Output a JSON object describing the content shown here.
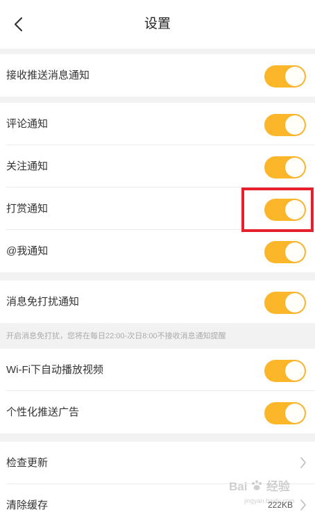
{
  "header": {
    "title": "设置",
    "back_icon": "chevron-left-icon"
  },
  "groups": {
    "push": {
      "items": [
        {
          "label": "接收推送消息通知",
          "on": true
        }
      ]
    },
    "notify": {
      "items": [
        {
          "label": "评论通知",
          "on": true
        },
        {
          "label": "关注通知",
          "on": true
        },
        {
          "label": "打赏通知",
          "on": true
        },
        {
          "label": "@我通知",
          "on": true
        }
      ]
    },
    "dnd": {
      "items": [
        {
          "label": "消息免打扰通知",
          "on": true
        }
      ],
      "hint": "开启消息免打扰，您将在每日22:00-次日8:00不接收消息通知提醒"
    },
    "media": {
      "items": [
        {
          "label": "Wi-Fi下自动播放视频",
          "on": true
        },
        {
          "label": "个性化推送广告",
          "on": true
        }
      ]
    },
    "misc": {
      "check_update": {
        "label": "检查更新"
      },
      "clear_cache": {
        "label": "清除缓存",
        "value": "222KB"
      }
    }
  },
  "colors": {
    "toggle_on": "#fcb62a",
    "highlight_box": "#e5202c",
    "background": "#f2f2f2",
    "surface": "#ffffff"
  },
  "watermark": {
    "text": "Bai",
    "paw_text": "经验",
    "sub": "jingyan.baidu.com"
  }
}
